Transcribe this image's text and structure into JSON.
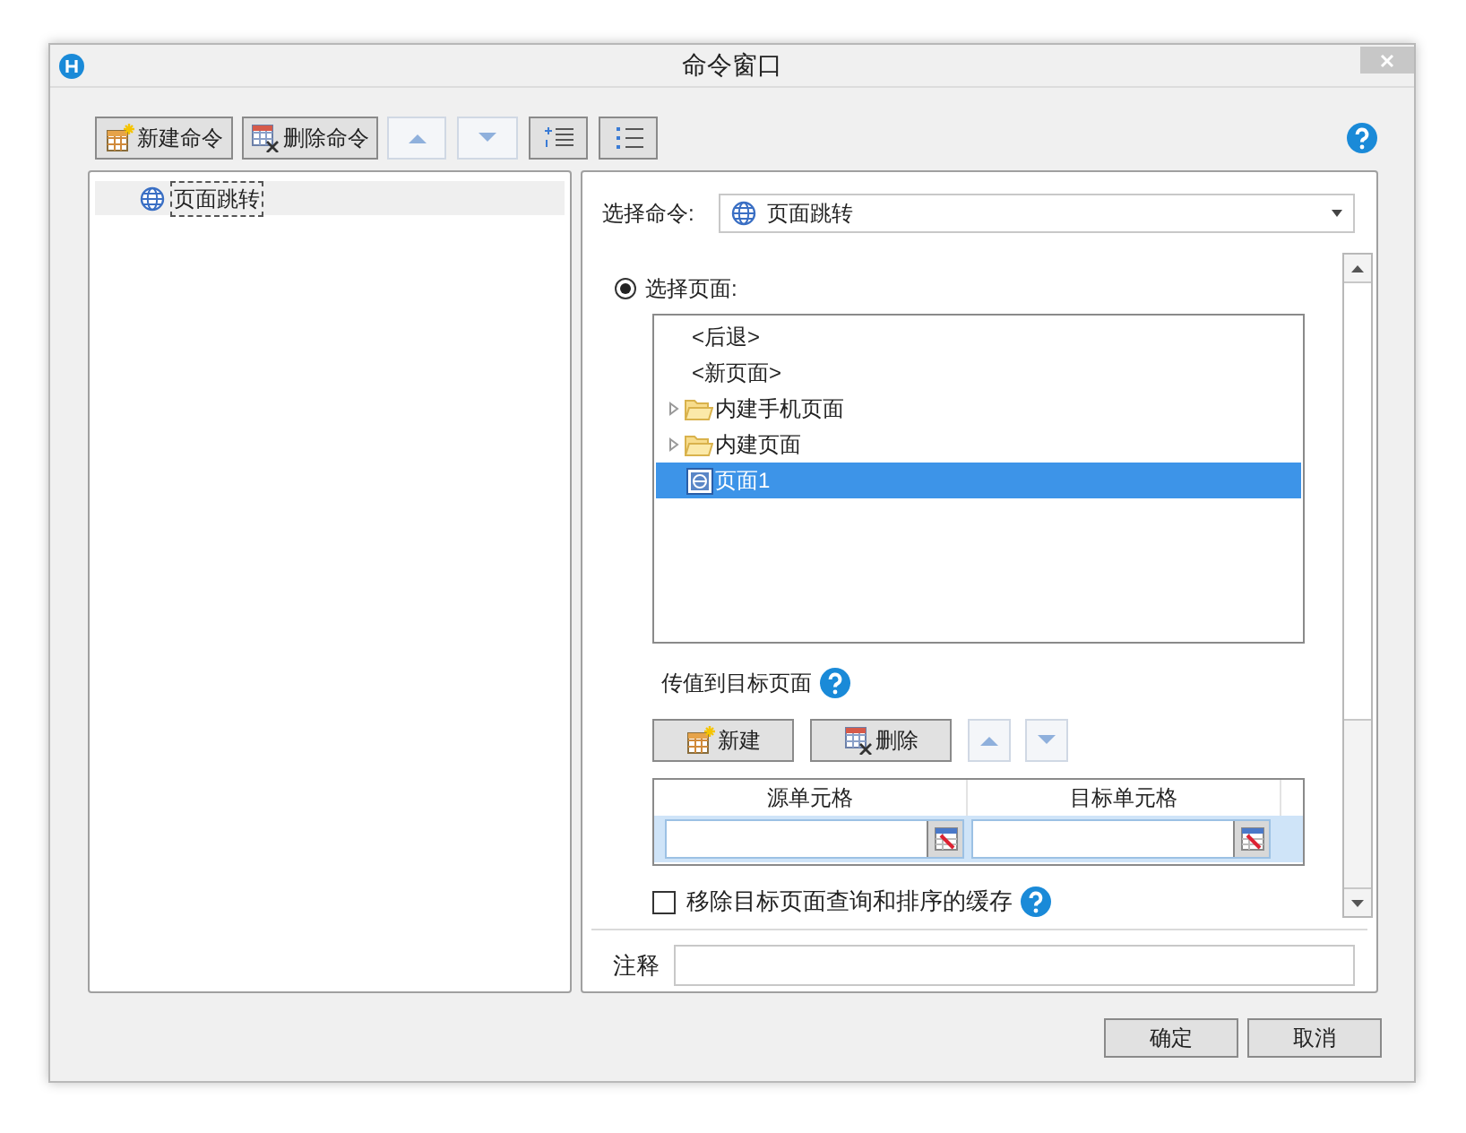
{
  "window": {
    "title": "命令窗口"
  },
  "toolbar": [
    {
      "kind": "new",
      "label": "新建命令",
      "disabled": false
    },
    {
      "kind": "delete",
      "label": "删除命令",
      "disabled": false
    },
    {
      "kind": "up",
      "disabled": true
    },
    {
      "kind": "down",
      "disabled": true
    },
    {
      "kind": "indent",
      "disabled": false
    },
    {
      "kind": "outdent",
      "disabled": false
    }
  ],
  "command_tree": [
    {
      "label": "页面跳转",
      "selected": true
    }
  ],
  "select_command": {
    "label": "选择命令:",
    "value": "页面跳转"
  },
  "select_page": {
    "label": "选择页面:",
    "selected": true
  },
  "page_list": [
    {
      "kind": "plain",
      "label": "<后退>",
      "selected": false
    },
    {
      "kind": "plain",
      "label": "<新页面>",
      "selected": false
    },
    {
      "kind": "folder",
      "label": "内建手机页面",
      "expanded": false,
      "selected": false
    },
    {
      "kind": "folder",
      "label": "内建页面",
      "expanded": false,
      "selected": false
    },
    {
      "kind": "page",
      "label": "页面1",
      "selected": true
    }
  ],
  "pass_values": {
    "label": "传值到目标页面",
    "buttons": [
      {
        "kind": "new",
        "label": "新建",
        "disabled": false
      },
      {
        "kind": "delete",
        "label": "删除",
        "disabled": false
      },
      {
        "kind": "up",
        "disabled": true
      },
      {
        "kind": "down",
        "disabled": true
      }
    ],
    "table": {
      "columns": [
        "源单元格",
        "目标单元格"
      ],
      "rows": [
        {
          "selected": true
        }
      ]
    }
  },
  "clear_cache": {
    "label": "移除目标页面查询和排序的缓存",
    "checked": false
  },
  "note": {
    "label": "注释"
  },
  "buttons": [
    "确定",
    "取消"
  ]
}
